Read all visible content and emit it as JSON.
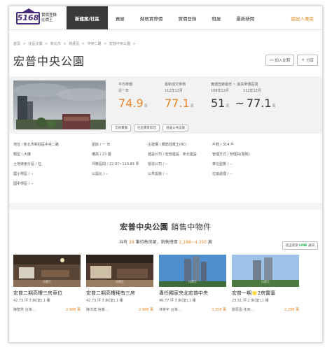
{
  "header": {
    "logo_number": "5168",
    "logo_line1": "實價登錄",
    "logo_line2": "比價王",
    "nav": [
      {
        "label": "新建案/社區",
        "active": true
      },
      {
        "label": "買屋",
        "active": false
      },
      {
        "label": "鄰居實際價",
        "active": false
      },
      {
        "label": "實價登錄",
        "active": false
      },
      {
        "label": "租屋",
        "active": false
      },
      {
        "label": "最新新聞",
        "active": false
      }
    ],
    "agent_label": "經紀人專區"
  },
  "breadcrumb": [
    "首頁",
    ">",
    "社區比價",
    ">",
    "新北市",
    ">",
    "新莊區",
    ">",
    "中央二路",
    ">",
    "宏普中央公園",
    ">"
  ],
  "title": "宏普中央公園",
  "actions": {
    "compare": "加入比較",
    "share": "分享"
  },
  "prices": {
    "avg_label": "平均單價",
    "avg_period": "近一年",
    "avg_value": "74.9",
    "latest_label": "最新成交單價",
    "latest_period": "112年12月",
    "latest_value": "77.1",
    "range_label": "實價登錄最低 ~ 最高單價區間",
    "range_from_period": "108年12月",
    "range_to_period": "112年12月",
    "range_low": "51",
    "range_sep": "~",
    "range_high": "77.1",
    "unit": "萬"
  },
  "tags": [
    "交易實價",
    "社區實景影音",
    "週邊公共設施"
  ],
  "info": [
    "地址 / 新北市新莊區中央二路",
    "屋齡 / 一 年",
    "主建構 / 鋼筋混凝土(RC)",
    "戶數 / 314 戶",
    "",
    "類型 / 大樓",
    "樓高 / 23 層",
    "建設公司 / 宏普建設．新北建設",
    "管理方式 / 管理員(警衛)",
    "",
    "土地使用分區 / 住",
    "坪數區間 / 22.97~110.83 坪",
    "營造公司 / --",
    "車位型態 / --",
    "",
    "國小學區 / --",
    "公設比 / --",
    "公共設施 / --",
    "垃圾處理 / --",
    "",
    "國中學區 / --"
  ],
  "listings": {
    "head_name": "宏普中央公園",
    "head_suffix": "銷售中物件",
    "sub_prefix": "共有",
    "count": "28",
    "sub_mid": "筆待售房屋，銷售總價",
    "price_range": "2,188~4,350",
    "sub_unit": "萬",
    "line_prefix": "社區新案",
    "line_word": "LINE",
    "line_suffix": "通知",
    "watermark": "比價王",
    "cards": [
      {
        "name": "宏普二期高樓三房車位",
        "meta": "42.73 坪 3 房(室) 1 樓",
        "agent": "陳聖男 台灣...",
        "price": "2,988 萬"
      },
      {
        "name": "宏普二期高樓稀有三房",
        "meta": "42.73 坪 3 房(室) 1 樓",
        "agent": "陳法渡 信義...",
        "price": "2,988 萬"
      },
      {
        "name": "專任獨家央北宏普中央",
        "meta": "46.77 坪 3 房(室) 1 樓",
        "agent": "林意宇 台灣...",
        "price": "3,358 萬"
      },
      {
        "name": "宏普一期🌟2房露臺",
        "meta": "23.51 坪 2 房(室) 1 樓",
        "agent": "劉思盈 住商...",
        "price": "2,288 萬"
      }
    ]
  }
}
